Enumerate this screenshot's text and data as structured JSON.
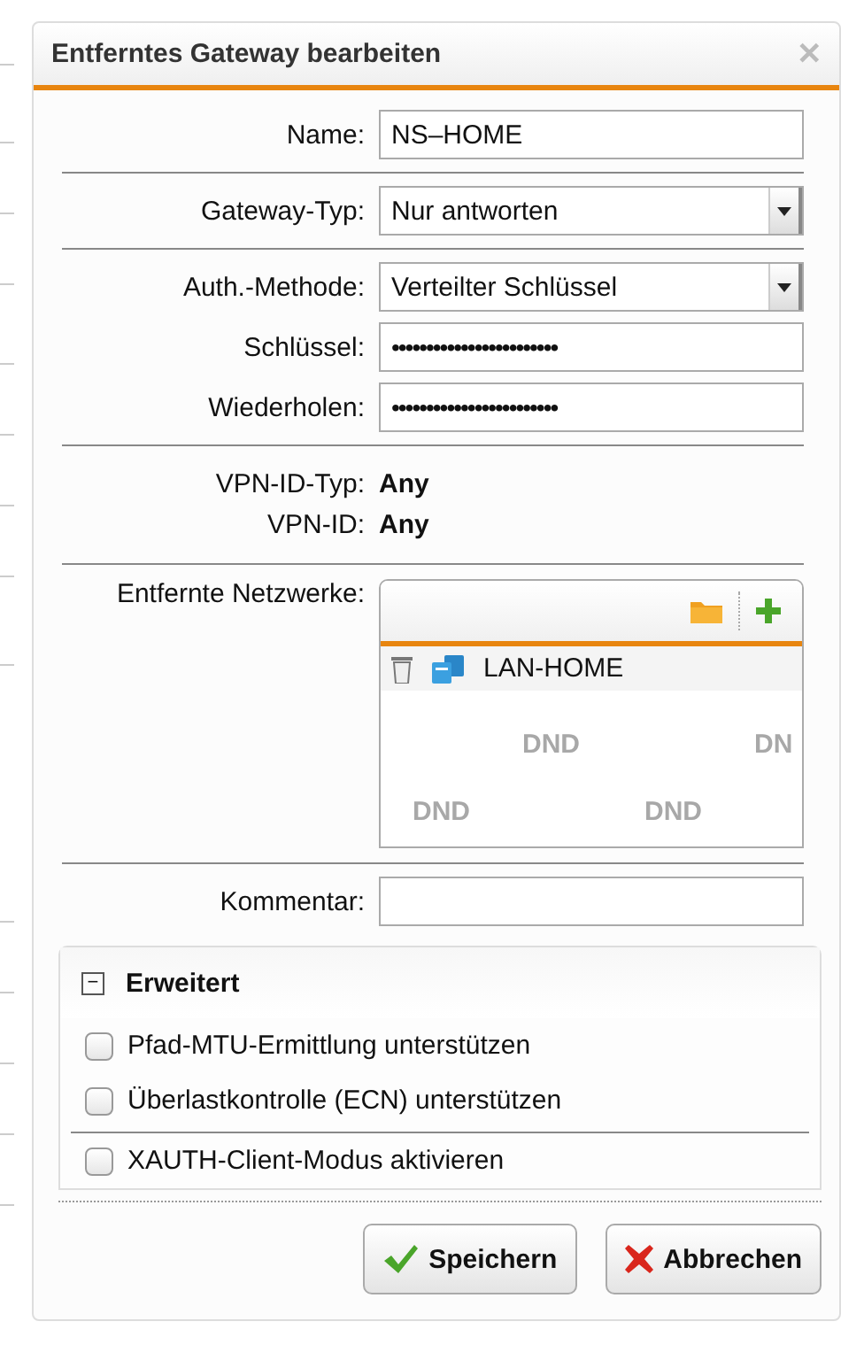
{
  "window": {
    "title": "Entferntes Gateway bearbeiten",
    "close": "✕"
  },
  "fields": [
    {
      "kind": "text",
      "label": "Name:",
      "value": "NS–HOME"
    },
    {
      "kind": "select",
      "label": "Gateway-Typ:",
      "value": "Nur antworten"
    },
    {
      "kind": "select",
      "label": "Auth.-Methode:",
      "value": "Verteilter Schlüssel"
    },
    {
      "kind": "password",
      "label": "Schlüssel:",
      "value": "••••••••••••••••••••••••"
    },
    {
      "kind": "password",
      "label": "Wiederholen:",
      "value": "••••••••••••••••••••••••"
    }
  ],
  "info": [
    {
      "label": "VPN-ID-Typ:",
      "value": "Any"
    },
    {
      "label": "VPN-ID:",
      "value": "Any"
    }
  ],
  "networks": {
    "label": "Entfernte Netzwerke:",
    "items": [
      {
        "name": "LAN-HOME"
      }
    ],
    "dnd_hints": [
      [
        "DND",
        "DN"
      ],
      [
        "DND",
        "DND"
      ]
    ]
  },
  "comment": {
    "label": "Kommentar:"
  },
  "advanced": {
    "title": "Erweitert",
    "expanded": true,
    "toggle": "−",
    "options": [
      {
        "label": "Pfad-MTU-Ermittlung unterstützen",
        "checked": false,
        "divider_above": false
      },
      {
        "label": "Überlastkontrolle (ECN) unterstützen",
        "checked": false,
        "divider_above": false
      },
      {
        "label": "XAUTH-Client-Modus aktivieren",
        "checked": false,
        "divider_above": true
      }
    ]
  },
  "buttons": [
    {
      "kind": "save",
      "label": "Speichern"
    },
    {
      "kind": "cancel",
      "label": "Abbrechen"
    }
  ]
}
